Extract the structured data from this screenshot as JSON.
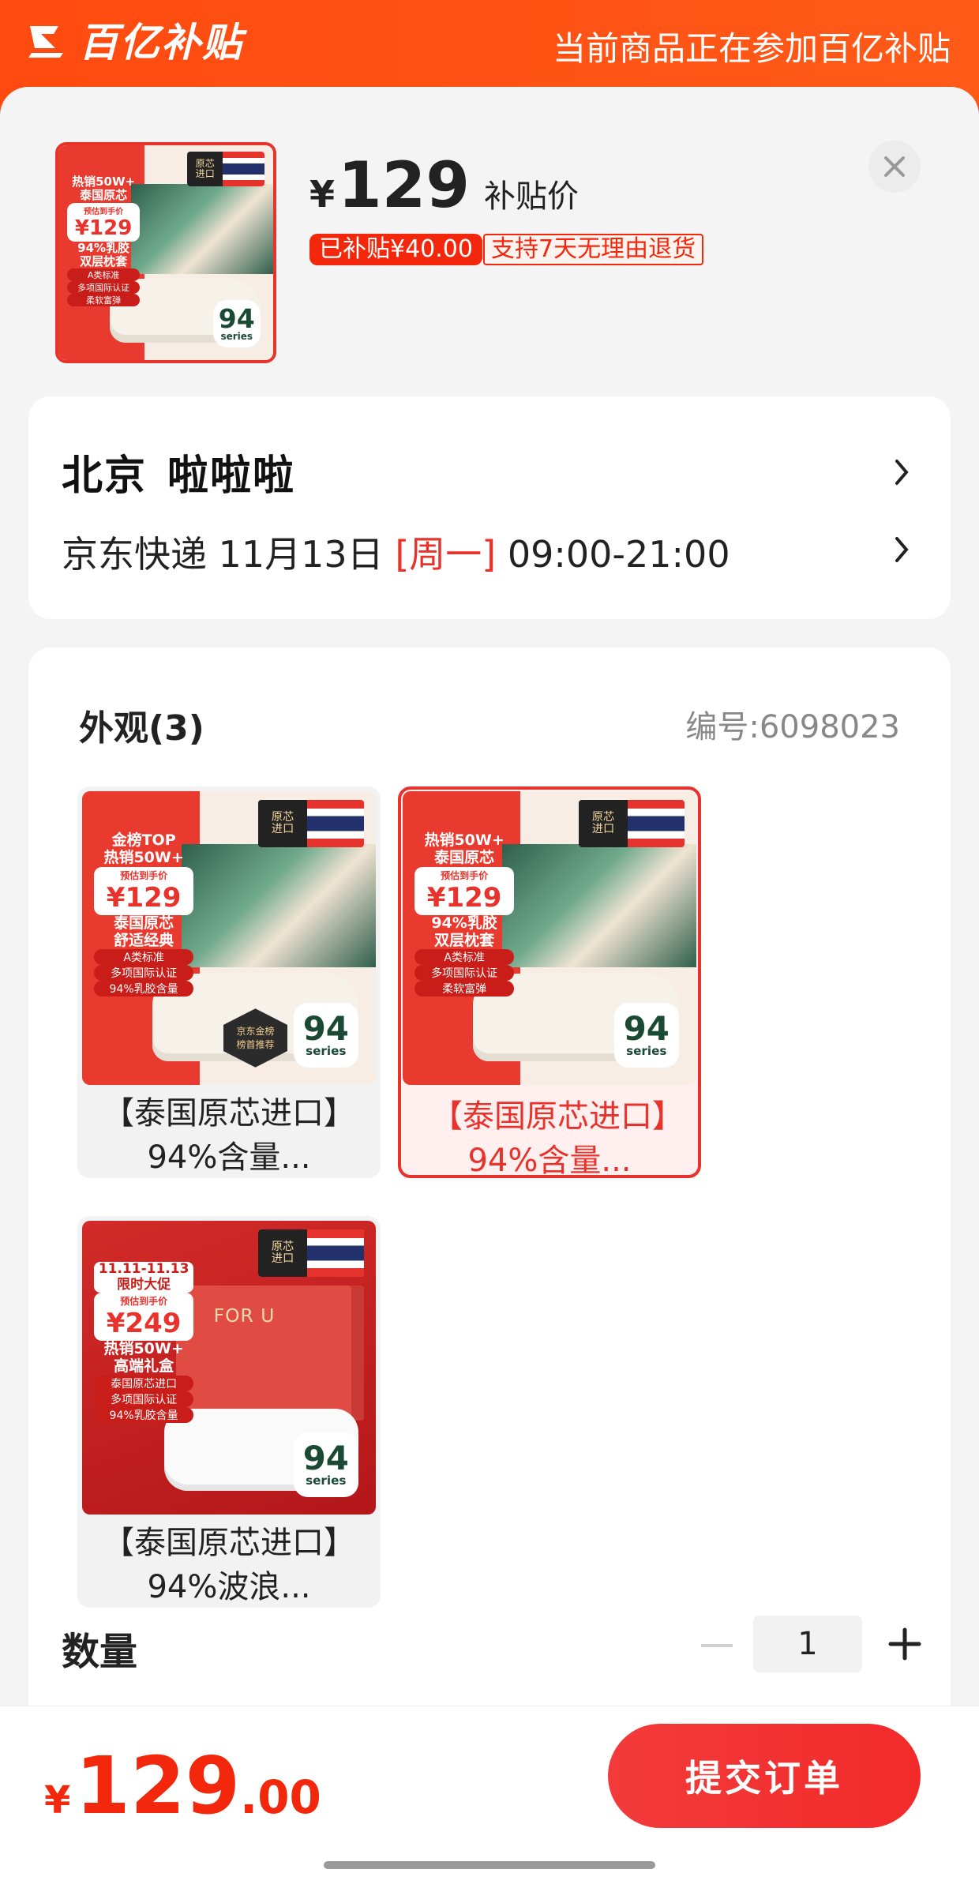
{
  "banner": {
    "brand": "百亿补贴",
    "notice": "当前商品正在参加百亿补贴"
  },
  "summary": {
    "currency": "¥",
    "price": "129",
    "price_label": "补贴价",
    "subsidy_tag": "已补贴¥40.00",
    "return_tag": "支持7天无理由退货",
    "thumb": {
      "promo_head": "热销50W+\n泰国原芯",
      "price_label": "预估到手价",
      "price": "¥129",
      "title": "94%乳胶\n双层枕套",
      "pills": [
        "A类标准",
        "多项国际认证",
        "柔软富弹"
      ],
      "badge_num": "94",
      "badge_sub": "series",
      "flag_text": "原芯\n进口"
    }
  },
  "address": {
    "city": "北京",
    "name": "啦啦啦",
    "carrier": "京东快递",
    "date": "11月13日",
    "weekday": "[周一]",
    "time_window": "09:00-21:00"
  },
  "selection": {
    "title": "外观(3)",
    "code": "编号:6098023",
    "options": [
      {
        "label": "【泰国原芯进口】94%含量...",
        "selected": false,
        "promo_head": "金榜TOP\n热销50W+",
        "price_label": "预估到手价",
        "price": "¥129",
        "title": "泰国原芯\n舒适经典",
        "pills": [
          "A类标准",
          "多项国际认证",
          "94%乳胶含量"
        ],
        "badge_num": "94",
        "badge_sub": "series",
        "flag_text": "原芯\n进口",
        "rank_badge": "京东金榜\n榜首推荐"
      },
      {
        "label": "【泰国原芯进口】94%含量...",
        "selected": true,
        "promo_head": "热销50W+\n泰国原芯",
        "price_label": "预估到手价",
        "price": "¥129",
        "title": "94%乳胶\n双层枕套",
        "pills": [
          "A类标准",
          "多项国际认证",
          "柔软富弹"
        ],
        "badge_num": "94",
        "badge_sub": "series",
        "flag_text": "原芯\n进口"
      },
      {
        "label": "【泰国原芯进口】94%波浪...",
        "selected": false,
        "promo_head": "11.11-11.13\n限时大促",
        "price_label": "预估到手价",
        "price": "¥249",
        "title": "热销50W+\n高端礼盒",
        "pills": [
          "泰国原芯进口",
          "多项国际认证",
          "94%乳胶含量"
        ],
        "badge_num": "94",
        "badge_sub": "series",
        "flag_text": "原芯\n进口",
        "box_text": "FOR U"
      }
    ]
  },
  "quantity": {
    "label": "数量",
    "value": "1"
  },
  "footer": {
    "currency": "¥",
    "total_int": "129",
    "total_dec": ".00",
    "submit_label": "提交订单"
  },
  "colors": {
    "brand_orange": "#ff4a10",
    "accent_red": "#f2270c",
    "selected_border": "#e8322c"
  },
  "icons": {
    "close": "close-icon",
    "chevron": "chevron-right-icon",
    "minus": "minus-icon",
    "plus": "plus-icon"
  }
}
